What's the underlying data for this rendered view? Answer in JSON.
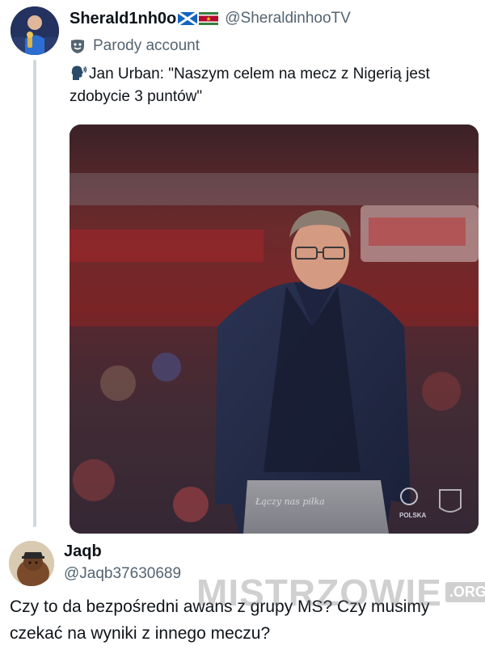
{
  "tweet": {
    "display_name": "Sherald1nh0o",
    "flags": [
      "scotland-flag-icon",
      "suriname-flag-icon"
    ],
    "handle": "@SheraldinhooTV",
    "account_label": "Parody account",
    "text": "Jan Urban: \"Naszym celem na mecz z Nigerią jest zdobycie 3 puntów\"",
    "emoji": "speaking-head-icon",
    "media": {
      "subject": "photo-coach-in-navy-suit",
      "watermark_text": "Łączy nas piłka",
      "badge_text": "POLSKA"
    }
  },
  "reply": {
    "display_name": "Jaqb",
    "handle": "@Jaqb37630689",
    "text": "Czy to da bezpośredni awans z grupy MS? Czy musimy czekać na wyniki z innego meczu?"
  },
  "site_watermark": {
    "text": "MISTRZOWIE",
    "suffix": ".ORG"
  },
  "colors": {
    "text_primary": "#0f1419",
    "text_secondary": "#536471",
    "thread_line": "#cfd9de"
  }
}
